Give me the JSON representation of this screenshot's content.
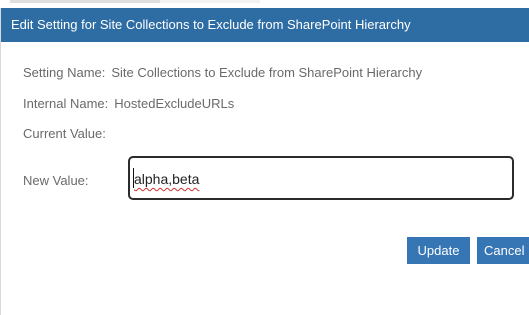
{
  "dialog": {
    "title": "Edit Setting for Site Collections to Exclude from SharePoint Hierarchy",
    "fields": {
      "setting_name_label": "Setting Name:",
      "setting_name_value": "Site Collections to Exclude from SharePoint Hierarchy",
      "internal_name_label": "Internal Name:",
      "internal_name_value": "HostedExcludeURLs",
      "current_value_label": "Current Value:",
      "current_value_value": "",
      "new_value_label": "New Value:",
      "new_value_input": "alpha,beta"
    },
    "buttons": {
      "update": "Update",
      "cancel": "Cancel"
    }
  },
  "colors": {
    "titlebar": "#2e6da4",
    "button": "#3676b5",
    "label_text": "#6a6a6a"
  }
}
